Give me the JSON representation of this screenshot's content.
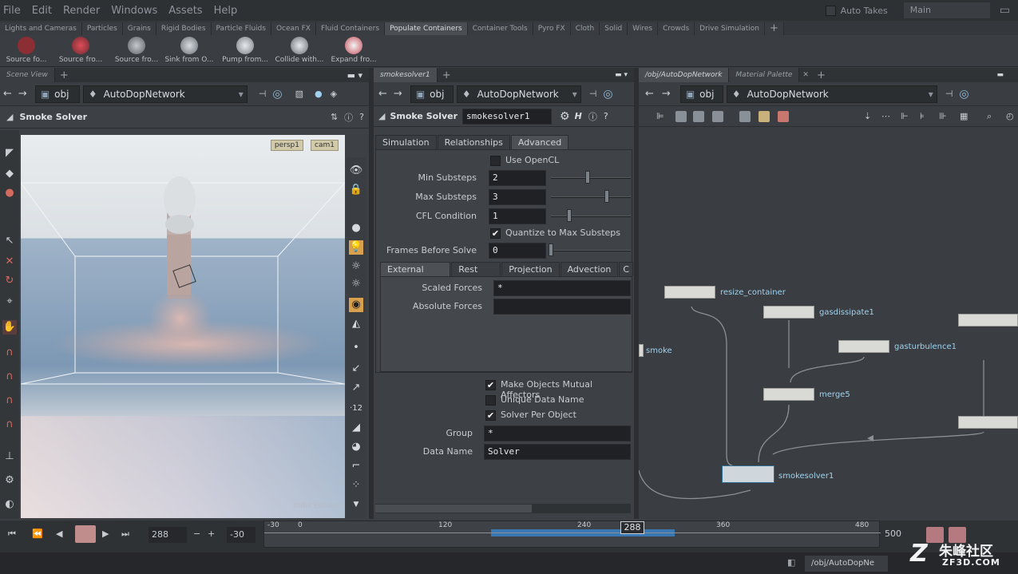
{
  "menu": [
    "File",
    "Edit",
    "Render",
    "Windows",
    "Assets",
    "Help"
  ],
  "menu_right": {
    "auto_takes": "Auto Takes",
    "take": "Main"
  },
  "shelf_tabs": [
    "Lights and Cameras",
    "Particles",
    "Grains",
    "Rigid Bodies",
    "Particle Fluids",
    "Ocean FX",
    "Fluid Containers",
    "Populate Containers",
    "Container Tools",
    "Pyro FX",
    "Cloth",
    "Solid",
    "Wires",
    "Crowds",
    "Drive Simulation"
  ],
  "shelf_active": "Populate Containers",
  "shelf_tools": [
    "Source fo...",
    "Source fro...",
    "Source fro...",
    "Sink from O...",
    "Pump from...",
    "Collide with...",
    "Expand fro..."
  ],
  "viewer": {
    "tab": "Scene View",
    "path": "obj",
    "network": "AutoDopNetwork",
    "title": "Smoke Solver",
    "persp": "persp1",
    "cam": "cam1",
    "watermark": "Indie Edition"
  },
  "params": {
    "tab": "smokesolver1",
    "path": "obj",
    "network": "AutoDopNetwork",
    "node_type": "Smoke Solver",
    "node_name": "smokesolver1",
    "tabs": [
      "Simulation",
      "Relationships",
      "Advanced"
    ],
    "active_tab": "Advanced",
    "use_opencl": "Use OpenCL",
    "min_substeps_label": "Min Substeps",
    "min_substeps": "2",
    "max_substeps_label": "Max Substeps",
    "max_substeps": "3",
    "cfl_label": "CFL Condition",
    "cfl": "1",
    "quantize": "Quantize to Max Substeps",
    "frames_before_label": "Frames Before Solve",
    "frames_before": "0",
    "subtabs": [
      "External Forces",
      "Rest Field",
      "Projection",
      "Advection",
      "C"
    ],
    "scaled_forces_label": "Scaled Forces",
    "scaled_forces": "*",
    "absolute_forces_label": "Absolute Forces",
    "absolute_forces": "",
    "mutual": "Make Objects Mutual Affectors",
    "unique": "Unique Data Name",
    "per_object": "Solver Per Object",
    "group_label": "Group",
    "group": "*",
    "data_name_label": "Data Name",
    "data_name": "Solver"
  },
  "network": {
    "tabs": [
      "/obj/AutoDopNetwork",
      "Material Palette"
    ],
    "path": "obj",
    "network": "AutoDopNetwork",
    "nodes": [
      "resize_container",
      "gasdissipate1",
      "gasturbulence1",
      "smoke",
      "merge5",
      "smokesolver1"
    ]
  },
  "timeline": {
    "start": "288",
    "step": "-30",
    "frame": "288",
    "ticks": [
      "-30",
      "0",
      "120",
      "240",
      "360",
      "480"
    ],
    "end": "500"
  },
  "status": {
    "path": "/obj/AutoDopNe"
  },
  "logo": {
    "cn": "朱峰社区",
    "en": "ZF3D.COM"
  }
}
